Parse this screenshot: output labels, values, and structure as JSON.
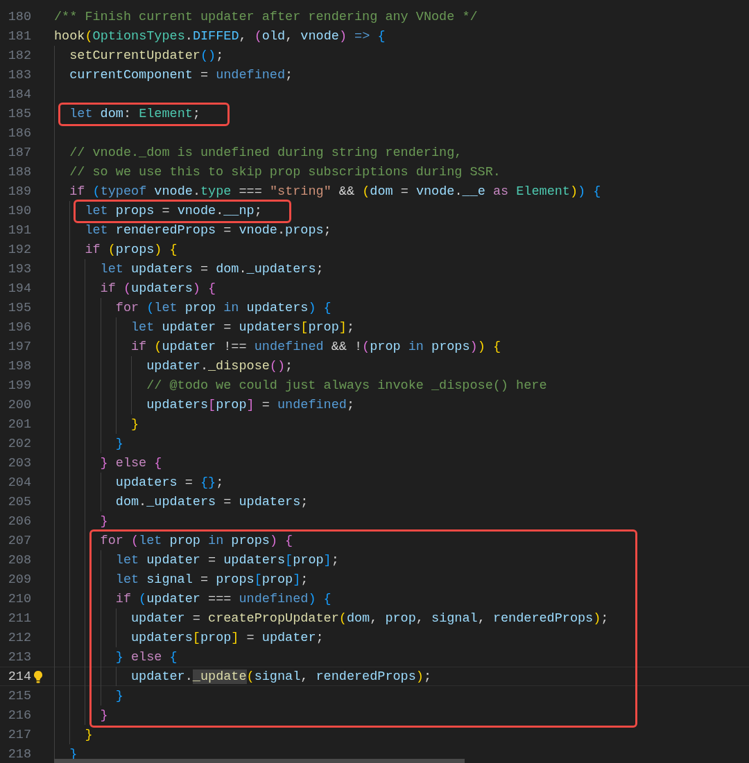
{
  "editor": {
    "blocks": [
      {
        "boxed": false,
        "lines": [
          {
            "number": "180",
            "current": false,
            "hint": false,
            "tokens": [
              {
                "text": "/** Finish current updater after rendering any VNode */",
                "kind": "comment"
              }
            ]
          },
          {
            "number": "181",
            "current": false,
            "hint": false,
            "tokens": [
              {
                "text": "hook",
                "kind": "function"
              },
              {
                "text": "(",
                "kind": "bracket1"
              },
              {
                "text": "OptionsTypes",
                "kind": "type"
              },
              {
                "text": ".",
                "kind": "punct"
              },
              {
                "text": "DIFFED",
                "kind": "constant"
              },
              {
                "text": ", ",
                "kind": "punct"
              },
              {
                "text": "(",
                "kind": "bracket2"
              },
              {
                "text": "old",
                "kind": "variable"
              },
              {
                "text": ", ",
                "kind": "punct"
              },
              {
                "text": "vnode",
                "kind": "variable"
              },
              {
                "text": ")",
                "kind": "bracket2"
              },
              {
                "text": " =>",
                "kind": "keyword"
              },
              {
                "text": " {",
                "kind": "bracket3"
              }
            ]
          },
          {
            "number": "182",
            "current": false,
            "hint": false,
            "tokens": [
              {
                "text": "  setCurrentUpdater",
                "kind": "function"
              },
              {
                "text": "()",
                "kind": "bracket3"
              },
              {
                "text": ";",
                "kind": "punct"
              }
            ]
          },
          {
            "number": "183",
            "current": false,
            "hint": false,
            "tokens": [
              {
                "text": "  currentComponent",
                "kind": "variable"
              },
              {
                "text": " = ",
                "kind": "punct"
              },
              {
                "text": "undefined",
                "kind": "keyword"
              },
              {
                "text": ";",
                "kind": "punct"
              }
            ]
          },
          {
            "number": "184",
            "current": false,
            "hint": false
          }
        ]
      },
      {
        "boxed": true,
        "lines": [
          {
            "number": "185",
            "current": false,
            "hint": false,
            "tokens": [
              {
                "text": "  let",
                "kind": "keyword"
              },
              {
                "text": " dom",
                "kind": "variable"
              },
              {
                "text": ": ",
                "kind": "punct"
              },
              {
                "text": "Element",
                "kind": "type"
              },
              {
                "text": ";",
                "kind": "punct"
              }
            ]
          }
        ]
      },
      {
        "boxed": false,
        "lines": [
          {
            "number": "186",
            "current": false,
            "hint": false
          },
          {
            "number": "187",
            "current": false,
            "hint": false,
            "tokens": [
              {
                "text": "  // vnode._dom is undefined during string rendering,",
                "kind": "comment"
              }
            ]
          },
          {
            "number": "188",
            "current": false,
            "hint": false,
            "tokens": [
              {
                "text": "  // so we use this to skip prop subscriptions during SSR.",
                "kind": "comment"
              }
            ]
          },
          {
            "number": "189",
            "current": false,
            "hint": false,
            "tokens": [
              {
                "text": "  if",
                "kind": "control"
              },
              {
                "text": " (",
                "kind": "bracket3"
              },
              {
                "text": "typeof",
                "kind": "keyword"
              },
              {
                "text": " vnode",
                "kind": "variable"
              },
              {
                "text": ".",
                "kind": "punct"
              },
              {
                "text": "type",
                "kind": "type"
              },
              {
                "text": " === ",
                "kind": "punct"
              },
              {
                "text": "\"string\"",
                "kind": "string"
              },
              {
                "text": " && ",
                "kind": "punct"
              },
              {
                "text": "(",
                "kind": "bracket1"
              },
              {
                "text": "dom",
                "kind": "variable"
              },
              {
                "text": " = ",
                "kind": "punct"
              },
              {
                "text": "vnode",
                "kind": "variable"
              },
              {
                "text": ".",
                "kind": "punct"
              },
              {
                "text": "__e",
                "kind": "variable"
              },
              {
                "text": " as",
                "kind": "control"
              },
              {
                "text": " Element",
                "kind": "type"
              },
              {
                "text": ")",
                "kind": "bracket1"
              },
              {
                "text": ")",
                "kind": "bracket3"
              },
              {
                "text": " {",
                "kind": "bracket3"
              }
            ]
          }
        ]
      },
      {
        "boxed": true,
        "lines": [
          {
            "number": "190",
            "current": false,
            "hint": false,
            "tokens": [
              {
                "text": "    let",
                "kind": "keyword"
              },
              {
                "text": " props",
                "kind": "variable"
              },
              {
                "text": " = ",
                "kind": "punct"
              },
              {
                "text": "vnode",
                "kind": "variable"
              },
              {
                "text": ".",
                "kind": "punct"
              },
              {
                "text": "__np",
                "kind": "variable"
              },
              {
                "text": ";",
                "kind": "punct"
              }
            ]
          }
        ]
      },
      {
        "boxed": false,
        "lines": [
          {
            "number": "191",
            "current": false,
            "hint": false,
            "tokens": [
              {
                "text": "    let",
                "kind": "keyword"
              },
              {
                "text": " renderedProps",
                "kind": "variable"
              },
              {
                "text": " = ",
                "kind": "punct"
              },
              {
                "text": "vnode",
                "kind": "variable"
              },
              {
                "text": ".",
                "kind": "punct"
              },
              {
                "text": "props",
                "kind": "variable"
              },
              {
                "text": ";",
                "kind": "punct"
              }
            ]
          },
          {
            "number": "192",
            "current": false,
            "hint": false,
            "tokens": [
              {
                "text": "    if",
                "kind": "control"
              },
              {
                "text": " (",
                "kind": "bracket1"
              },
              {
                "text": "props",
                "kind": "variable"
              },
              {
                "text": ")",
                "kind": "bracket1"
              },
              {
                "text": " {",
                "kind": "bracket1"
              }
            ]
          },
          {
            "number": "193",
            "current": false,
            "hint": false,
            "tokens": [
              {
                "text": "      let",
                "kind": "keyword"
              },
              {
                "text": " updaters",
                "kind": "variable"
              },
              {
                "text": " = ",
                "kind": "punct"
              },
              {
                "text": "dom",
                "kind": "variable"
              },
              {
                "text": ".",
                "kind": "punct"
              },
              {
                "text": "_updaters",
                "kind": "variable"
              },
              {
                "text": ";",
                "kind": "punct"
              }
            ]
          },
          {
            "number": "194",
            "current": false,
            "hint": false,
            "tokens": [
              {
                "text": "      if",
                "kind": "control"
              },
              {
                "text": " (",
                "kind": "bracket2"
              },
              {
                "text": "updaters",
                "kind": "variable"
              },
              {
                "text": ")",
                "kind": "bracket2"
              },
              {
                "text": " {",
                "kind": "bracket2"
              }
            ]
          },
          {
            "number": "195",
            "current": false,
            "hint": false,
            "tokens": [
              {
                "text": "        for",
                "kind": "control"
              },
              {
                "text": " (",
                "kind": "bracket3"
              },
              {
                "text": "let",
                "kind": "keyword"
              },
              {
                "text": " prop",
                "kind": "variable"
              },
              {
                "text": " in",
                "kind": "keyword"
              },
              {
                "text": " updaters",
                "kind": "variable"
              },
              {
                "text": ")",
                "kind": "bracket3"
              },
              {
                "text": " {",
                "kind": "bracket3"
              }
            ]
          },
          {
            "number": "196",
            "current": false,
            "hint": false,
            "tokens": [
              {
                "text": "          let",
                "kind": "keyword"
              },
              {
                "text": " updater",
                "kind": "variable"
              },
              {
                "text": " = ",
                "kind": "punct"
              },
              {
                "text": "updaters",
                "kind": "variable"
              },
              {
                "text": "[",
                "kind": "bracket1"
              },
              {
                "text": "prop",
                "kind": "variable"
              },
              {
                "text": "]",
                "kind": "bracket1"
              },
              {
                "text": ";",
                "kind": "punct"
              }
            ]
          },
          {
            "number": "197",
            "current": false,
            "hint": false,
            "tokens": [
              {
                "text": "          if",
                "kind": "control"
              },
              {
                "text": " (",
                "kind": "bracket1"
              },
              {
                "text": "updater",
                "kind": "variable"
              },
              {
                "text": " !== ",
                "kind": "punct"
              },
              {
                "text": "undefined",
                "kind": "keyword"
              },
              {
                "text": " && !",
                "kind": "punct"
              },
              {
                "text": "(",
                "kind": "bracket2"
              },
              {
                "text": "prop",
                "kind": "variable"
              },
              {
                "text": " in",
                "kind": "keyword"
              },
              {
                "text": " props",
                "kind": "variable"
              },
              {
                "text": ")",
                "kind": "bracket2"
              },
              {
                "text": ")",
                "kind": "bracket1"
              },
              {
                "text": " {",
                "kind": "bracket1"
              }
            ]
          },
          {
            "number": "198",
            "current": false,
            "hint": false,
            "tokens": [
              {
                "text": "            updater",
                "kind": "variable"
              },
              {
                "text": ".",
                "kind": "punct"
              },
              {
                "text": "_dispose",
                "kind": "function"
              },
              {
                "text": "()",
                "kind": "bracket2"
              },
              {
                "text": ";",
                "kind": "punct"
              }
            ]
          },
          {
            "number": "199",
            "current": false,
            "hint": false,
            "tokens": [
              {
                "text": "            // @todo we could just always invoke _dispose() here",
                "kind": "comment"
              }
            ]
          },
          {
            "number": "200",
            "current": false,
            "hint": false,
            "tokens": [
              {
                "text": "            updaters",
                "kind": "variable"
              },
              {
                "text": "[",
                "kind": "bracket2"
              },
              {
                "text": "prop",
                "kind": "variable"
              },
              {
                "text": "]",
                "kind": "bracket2"
              },
              {
                "text": " = ",
                "kind": "punct"
              },
              {
                "text": "undefined",
                "kind": "keyword"
              },
              {
                "text": ";",
                "kind": "punct"
              }
            ]
          },
          {
            "number": "201",
            "current": false,
            "hint": false,
            "tokens": [
              {
                "text": "          }",
                "kind": "bracket1"
              }
            ]
          },
          {
            "number": "202",
            "current": false,
            "hint": false,
            "tokens": [
              {
                "text": "        }",
                "kind": "bracket3"
              }
            ]
          },
          {
            "number": "203",
            "current": false,
            "hint": false,
            "tokens": [
              {
                "text": "      }",
                "kind": "bracket2"
              },
              {
                "text": " else",
                "kind": "control"
              },
              {
                "text": " {",
                "kind": "bracket2"
              }
            ]
          },
          {
            "number": "204",
            "current": false,
            "hint": false,
            "tokens": [
              {
                "text": "        updaters",
                "kind": "variable"
              },
              {
                "text": " = ",
                "kind": "punct"
              },
              {
                "text": "{}",
                "kind": "bracket3"
              },
              {
                "text": ";",
                "kind": "punct"
              }
            ]
          },
          {
            "number": "205",
            "current": false,
            "hint": false,
            "tokens": [
              {
                "text": "        dom",
                "kind": "variable"
              },
              {
                "text": ".",
                "kind": "punct"
              },
              {
                "text": "_updaters",
                "kind": "variable"
              },
              {
                "text": " = ",
                "kind": "punct"
              },
              {
                "text": "updaters",
                "kind": "variable"
              },
              {
                "text": ";",
                "kind": "punct"
              }
            ]
          },
          {
            "number": "206",
            "current": false,
            "hint": false,
            "tokens": [
              {
                "text": "      }",
                "kind": "bracket2"
              }
            ]
          }
        ]
      },
      {
        "boxed": true,
        "lines": [
          {
            "number": "207",
            "current": false,
            "hint": false,
            "tokens": [
              {
                "text": "      for",
                "kind": "control"
              },
              {
                "text": " (",
                "kind": "bracket2"
              },
              {
                "text": "let",
                "kind": "keyword"
              },
              {
                "text": " prop",
                "kind": "variable"
              },
              {
                "text": " in",
                "kind": "keyword"
              },
              {
                "text": " props",
                "kind": "variable"
              },
              {
                "text": ")",
                "kind": "bracket2"
              },
              {
                "text": " {",
                "kind": "bracket2"
              }
            ]
          },
          {
            "number": "208",
            "current": false,
            "hint": false,
            "tokens": [
              {
                "text": "        let",
                "kind": "keyword"
              },
              {
                "text": " updater",
                "kind": "variable"
              },
              {
                "text": " = ",
                "kind": "punct"
              },
              {
                "text": "updaters",
                "kind": "variable"
              },
              {
                "text": "[",
                "kind": "bracket3"
              },
              {
                "text": "prop",
                "kind": "variable"
              },
              {
                "text": "]",
                "kind": "bracket3"
              },
              {
                "text": ";",
                "kind": "punct"
              }
            ]
          },
          {
            "number": "209",
            "current": false,
            "hint": false,
            "tokens": [
              {
                "text": "        let",
                "kind": "keyword"
              },
              {
                "text": " signal",
                "kind": "variable"
              },
              {
                "text": " = ",
                "kind": "punct"
              },
              {
                "text": "props",
                "kind": "variable"
              },
              {
                "text": "[",
                "kind": "bracket3"
              },
              {
                "text": "prop",
                "kind": "variable"
              },
              {
                "text": "]",
                "kind": "bracket3"
              },
              {
                "text": ";",
                "kind": "punct"
              }
            ]
          },
          {
            "number": "210",
            "current": false,
            "hint": false,
            "tokens": [
              {
                "text": "        if",
                "kind": "control"
              },
              {
                "text": " (",
                "kind": "bracket3"
              },
              {
                "text": "updater",
                "kind": "variable"
              },
              {
                "text": " === ",
                "kind": "punct"
              },
              {
                "text": "undefined",
                "kind": "keyword"
              },
              {
                "text": ")",
                "kind": "bracket3"
              },
              {
                "text": " {",
                "kind": "bracket3"
              }
            ]
          },
          {
            "number": "211",
            "current": false,
            "hint": false,
            "tokens": [
              {
                "text": "          updater",
                "kind": "variable"
              },
              {
                "text": " = ",
                "kind": "punct"
              },
              {
                "text": "createPropUpdater",
                "kind": "function"
              },
              {
                "text": "(",
                "kind": "bracket1"
              },
              {
                "text": "dom",
                "kind": "variable"
              },
              {
                "text": ", ",
                "kind": "punct"
              },
              {
                "text": "prop",
                "kind": "variable"
              },
              {
                "text": ", ",
                "kind": "punct"
              },
              {
                "text": "signal",
                "kind": "variable"
              },
              {
                "text": ", ",
                "kind": "punct"
              },
              {
                "text": "renderedProps",
                "kind": "variable"
              },
              {
                "text": ")",
                "kind": "bracket1"
              },
              {
                "text": ";",
                "kind": "punct"
              }
            ]
          },
          {
            "number": "212",
            "current": false,
            "hint": false,
            "tokens": [
              {
                "text": "          updaters",
                "kind": "variable"
              },
              {
                "text": "[",
                "kind": "bracket1"
              },
              {
                "text": "prop",
                "kind": "variable"
              },
              {
                "text": "]",
                "kind": "bracket1"
              },
              {
                "text": " = ",
                "kind": "punct"
              },
              {
                "text": "updater",
                "kind": "variable"
              },
              {
                "text": ";",
                "kind": "punct"
              }
            ]
          },
          {
            "number": "213",
            "current": false,
            "hint": false,
            "tokens": [
              {
                "text": "        }",
                "kind": "bracket3"
              },
              {
                "text": " else",
                "kind": "control"
              },
              {
                "text": " {",
                "kind": "bracket3"
              }
            ]
          },
          {
            "number": "214",
            "current": true,
            "hint": true,
            "tokens": [
              {
                "text": "          updater",
                "kind": "variable"
              },
              {
                "text": ".",
                "kind": "punct"
              },
              {
                "text": "_update",
                "kind": "occurrence"
              },
              {
                "text": "(",
                "kind": "bracket1"
              },
              {
                "text": "signal",
                "kind": "variable"
              },
              {
                "text": ", ",
                "kind": "punct"
              },
              {
                "text": "renderedProps",
                "kind": "variable"
              },
              {
                "text": ")",
                "kind": "bracket1"
              },
              {
                "text": ";",
                "kind": "punct"
              }
            ]
          },
          {
            "number": "215",
            "current": false,
            "hint": false,
            "tokens": [
              {
                "text": "        }",
                "kind": "bracket3"
              }
            ]
          },
          {
            "number": "216",
            "current": false,
            "hint": false,
            "tokens": [
              {
                "text": "      }",
                "kind": "bracket2"
              }
            ]
          }
        ]
      },
      {
        "boxed": false,
        "lines": [
          {
            "number": "217",
            "current": false,
            "hint": false,
            "tokens": [
              {
                "text": "    }",
                "kind": "bracket1"
              }
            ]
          },
          {
            "number": "218",
            "current": false,
            "hint": false,
            "tokens": [
              {
                "text": "  }",
                "kind": "bracket3"
              }
            ]
          }
        ]
      }
    ]
  }
}
